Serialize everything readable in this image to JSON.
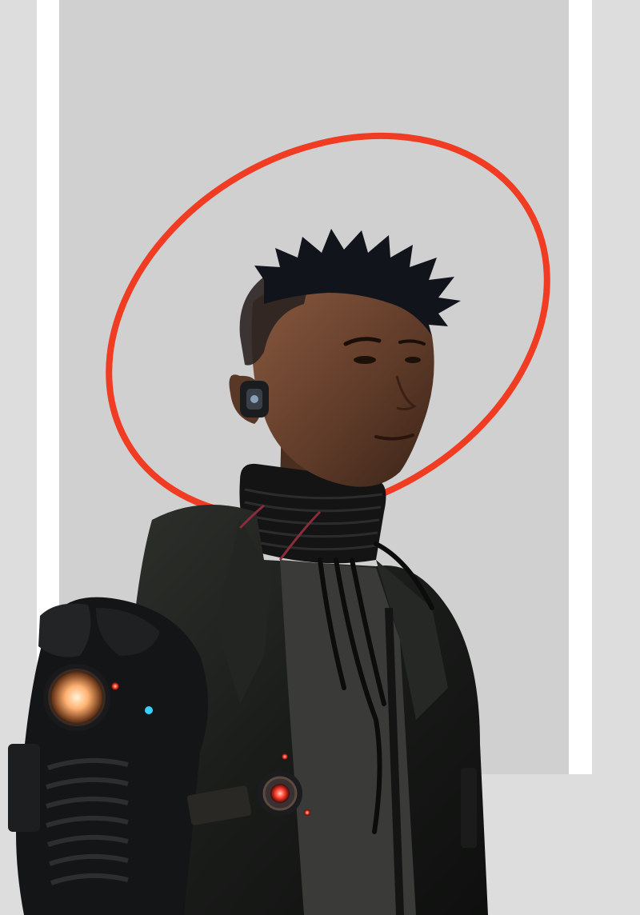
{
  "colors": {
    "page_background": "#dddddd",
    "frame_white": "#ffffff",
    "panel_grey": "#d0d0d0",
    "halo_accent": "#f03c22",
    "jacket_dark": "#1c1e1d",
    "skin_tone": "#6a4330",
    "hair_dark": "#12141c",
    "glow_warm": "#ffb070",
    "glow_red": "#ff3a2a",
    "glow_cyan": "#3ad0ff"
  },
  "icons": {
    "halo": "halo-ring-icon",
    "arm_light": "arm-glow-light-icon",
    "chest_light": "chest-core-light-icon"
  },
  "scene": {
    "subject": "cyberpunk-portrait"
  }
}
